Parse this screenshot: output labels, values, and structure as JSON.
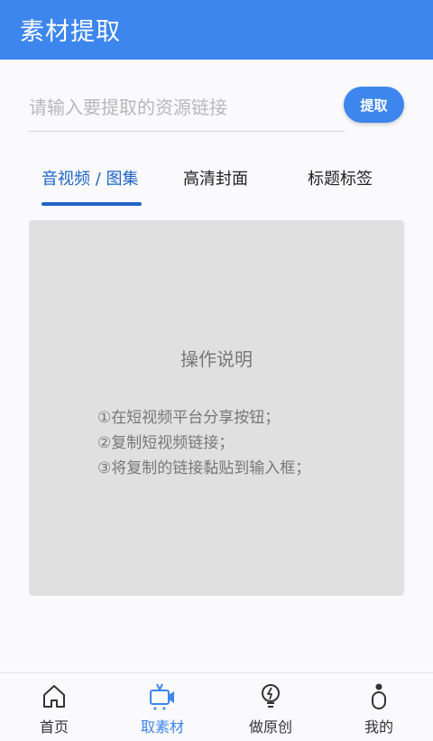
{
  "appbar": {
    "title": "素材提取"
  },
  "search": {
    "placeholder": "请输入要提取的资源链接",
    "value": "",
    "button_label": "提取"
  },
  "tabs": [
    {
      "label": "音视频 / 图集",
      "active": true
    },
    {
      "label": "高清封面",
      "active": false
    },
    {
      "label": "标题标签",
      "active": false
    }
  ],
  "instructions": {
    "title": "操作说明",
    "steps": [
      "①在短视频平台分享按钮；",
      "②复制短视频链接；",
      "③将复制的链接黏贴到输入框；"
    ]
  },
  "bottom_nav": [
    {
      "label": "首页",
      "icon": "home-icon",
      "active": false
    },
    {
      "label": "取素材",
      "icon": "camera-icon",
      "active": true
    },
    {
      "label": "做原创",
      "icon": "lightbulb-icon",
      "active": false
    },
    {
      "label": "我的",
      "icon": "user-icon",
      "active": false
    }
  ],
  "colors": {
    "primary": "#3d86ee",
    "tab_active": "#1f66c4",
    "card_bg": "#e0e0e0",
    "page_bg": "#faf9fc"
  }
}
